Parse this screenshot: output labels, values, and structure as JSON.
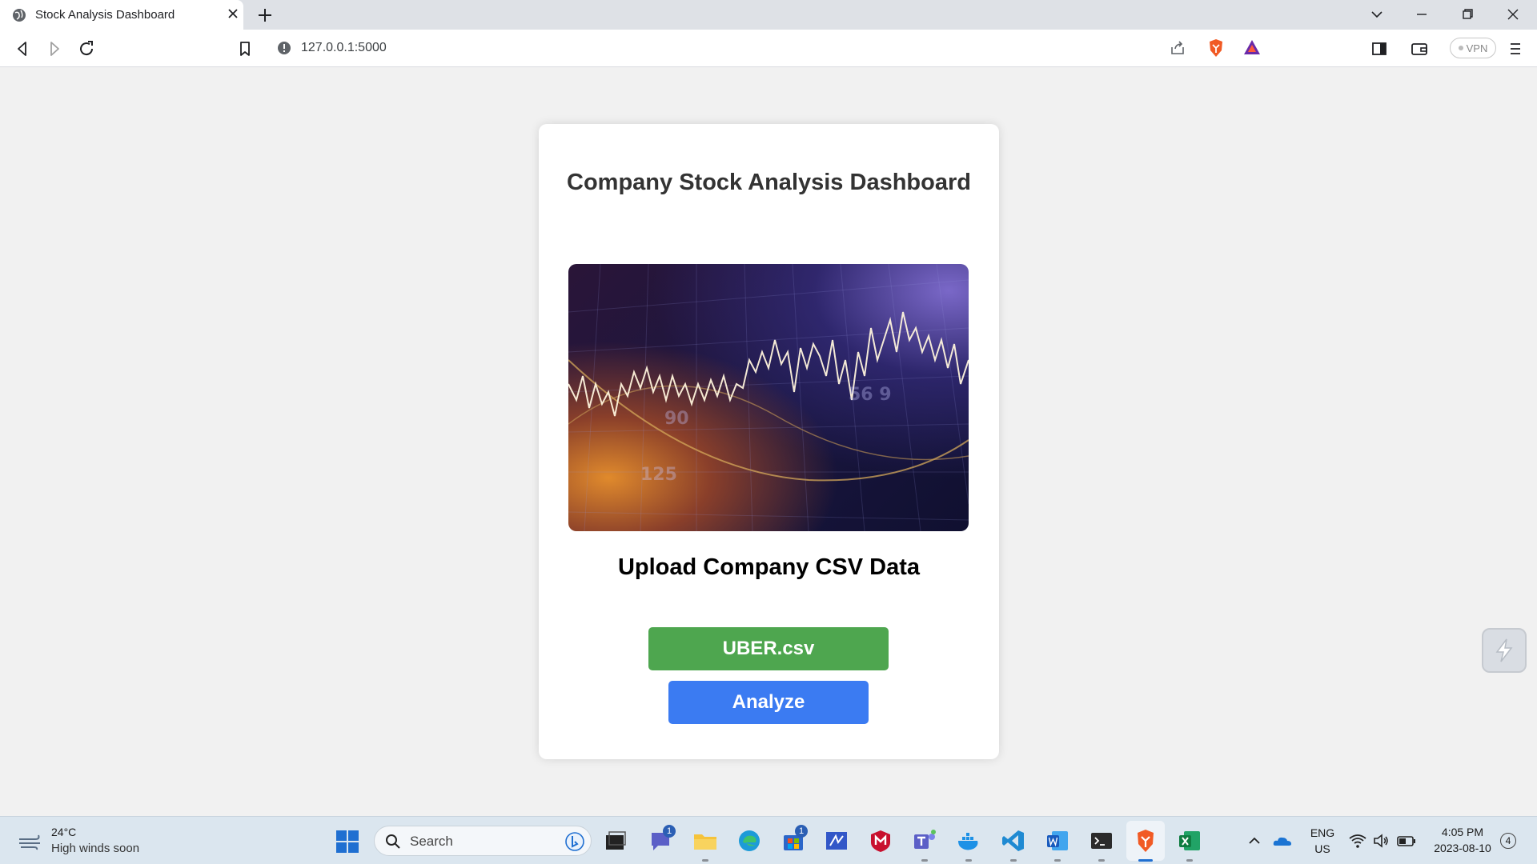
{
  "browser": {
    "tab_title": "Stock Analysis Dashboard",
    "url": "127.0.0.1:5000",
    "vpn_label": "VPN"
  },
  "page": {
    "title": "Company Stock Analysis Dashboard",
    "hero_image": "stock-market-chart-image",
    "upload_heading": "Upload Company CSV Data",
    "file_button_label": "UBER.csv",
    "analyze_button_label": "Analyze"
  },
  "taskbar": {
    "weather_temp": "24°C",
    "weather_desc": "High winds soon",
    "search_placeholder": "Search",
    "teams_badge": "1",
    "store_badge": "1",
    "language_line1": "ENG",
    "language_line2": "US",
    "time": "4:05 PM",
    "date": "2023-08-10",
    "notification_count": "4"
  },
  "colors": {
    "file_button": "#4ea64f",
    "analyze_button": "#3b7bf2",
    "page_background": "#f1f1f1"
  }
}
